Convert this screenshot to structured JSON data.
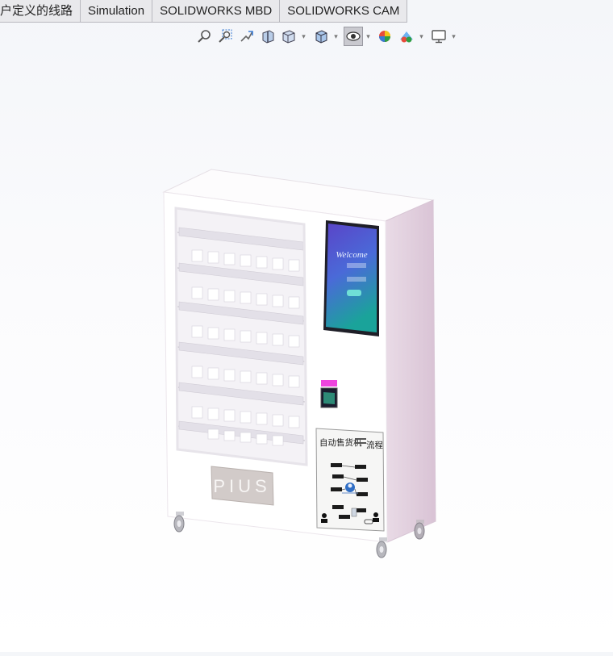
{
  "tabs": [
    {
      "label": "户定义的线路",
      "active": false
    },
    {
      "label": "Simulation",
      "active": false
    },
    {
      "label": "SOLIDWORKS MBD",
      "active": false
    },
    {
      "label": "SOLIDWORKS CAM",
      "active": false
    }
  ],
  "heads_up_toolbar": [
    {
      "icon": "zoom-to-fit-icon",
      "dropdown": false
    },
    {
      "icon": "zoom-to-area-icon",
      "dropdown": false
    },
    {
      "icon": "previous-view-icon",
      "dropdown": false
    },
    {
      "icon": "section-view-icon",
      "dropdown": false
    },
    {
      "icon": "view-orientation-icon",
      "dropdown": true
    },
    {
      "icon": "display-style-icon",
      "dropdown": true
    },
    {
      "icon": "hide-show-items-icon",
      "dropdown": true,
      "active": true
    },
    {
      "icon": "edit-appearance-icon",
      "dropdown": false
    },
    {
      "icon": "apply-scene-icon",
      "dropdown": true
    },
    {
      "icon": "view-settings-icon",
      "dropdown": true
    }
  ],
  "model": {
    "name": "vending-machine",
    "front_panel_label": "PIUS",
    "screen": {
      "welcome": "Welcome"
    },
    "flow_panel": {
      "title_left": "自动售货机",
      "title_right": "流程"
    }
  },
  "colors": {
    "side_panel": "#e4d3e1",
    "screen_top": "#5a44c8",
    "screen_bottom": "#1aa39a",
    "indicator": "#ee44dd"
  }
}
